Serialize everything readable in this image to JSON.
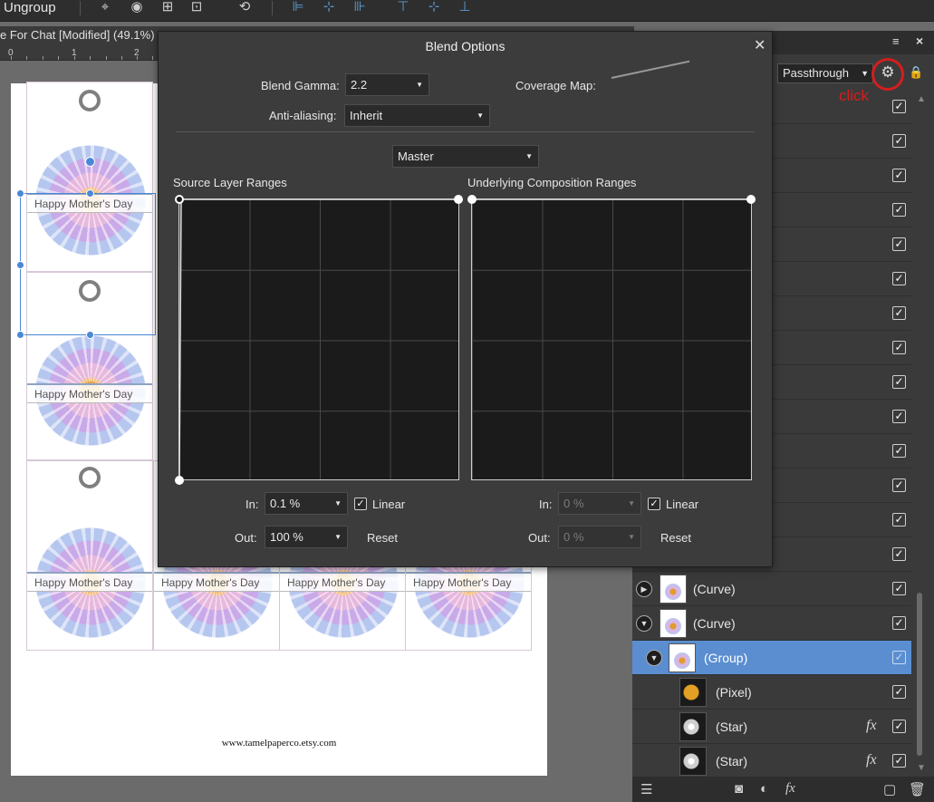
{
  "toolbar": {
    "ungroup_label": "Ungroup"
  },
  "document": {
    "title": "e For Chat [Modified] (49.1%)",
    "ruler_labels": [
      "0",
      "1",
      "2"
    ],
    "tag_text": "Happy Mother's Day",
    "website": "www.tamelpaperco.etsy.com"
  },
  "layers_panel": {
    "blend_mode": "Passthrough",
    "annotation": "click",
    "layers": [
      {
        "name": "(Curve)",
        "expander": "▶",
        "type": "curve"
      },
      {
        "name": "(Curve)",
        "expander": "▼",
        "type": "curve"
      },
      {
        "name": "(Group)",
        "expander": "▼",
        "type": "group",
        "selected": true
      },
      {
        "name": "(Pixel)",
        "type": "pixel"
      },
      {
        "name": "(Star)",
        "type": "star",
        "fx": "fx"
      },
      {
        "name": "(Star)",
        "type": "star",
        "fx": "fx"
      }
    ]
  },
  "dialog": {
    "title": "Blend Options",
    "blend_gamma_label": "Blend Gamma:",
    "blend_gamma_value": "2.2",
    "coverage_map_label": "Coverage Map:",
    "anti_aliasing_label": "Anti-aliasing:",
    "anti_aliasing_value": "Inherit",
    "channel_value": "Master",
    "source_ranges_label": "Source Layer Ranges",
    "underlying_ranges_label": "Underlying Composition Ranges",
    "in_label": "In:",
    "out_label": "Out:",
    "source_in_value": "0.1 %",
    "source_out_value": "100 %",
    "underlying_in_value": "0 %",
    "underlying_out_value": "0 %",
    "linear_label": "Linear",
    "reset_label": "Reset"
  },
  "colors": {
    "selection_blue": "#5a8ed0",
    "annotation_red": "#d41e1e",
    "dialog_bg": "#3c3c3c",
    "grid_bg": "#1b1b1b"
  }
}
